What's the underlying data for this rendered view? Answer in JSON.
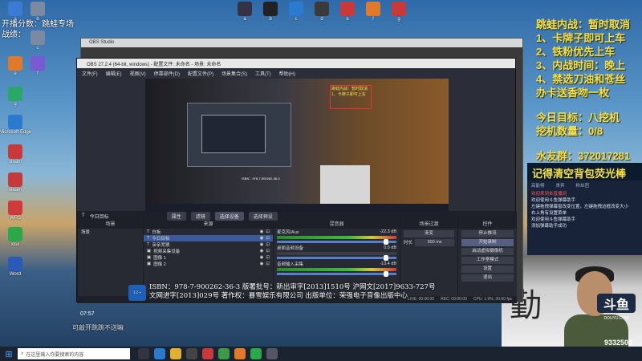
{
  "desktop_icons": [
    {
      "label": "a",
      "color": "#3b7bd4"
    },
    {
      "label": "b",
      "color": "#7a8aa0"
    },
    {
      "label": "c",
      "color": "#7a8aa0"
    },
    {
      "label": "e",
      "color": "#e07a2a"
    },
    {
      "label": "f",
      "color": "#7a5ad0"
    },
    {
      "label": "g",
      "color": "#2aa86a"
    },
    {
      "label": "Microsoft Edge",
      "color": "#2a7ad0"
    },
    {
      "label": "steam",
      "color": "#c83a3a"
    },
    {
      "label": "steam",
      "color": "#c83a3a"
    },
    {
      "label": "WPS",
      "color": "#d03a3a"
    },
    {
      "label": "xlsx",
      "color": "#2aa84a"
    },
    {
      "label": "Word",
      "color": "#2a5ab8"
    }
  ],
  "top_left_text": [
    "开播分数：跳蛙专场",
    "战绩："
  ],
  "rules": [
    "跳蛙内战：暂时取消",
    "1、卡牌子即可上车",
    "2、铁粉优先上车",
    "3、内战时间：晚上",
    "4、禁选刀油和苍丝",
    "办卡送香吻一枚",
    "",
    "今日目标：八挖机",
    "挖机数量：0/8",
    "",
    "水友群：372017281"
  ],
  "reminder": "记得清空背包荧光棒",
  "chat": {
    "tabs": [
      "高能榜",
      "贵宾",
      "粉丝团"
    ],
    "lines": [
      "欢迎来到本直播间",
      "欢迎使用斗鱼弹幕助手",
      "左键拖拽弹幕窗改变位置，左键拖拽边框改变大小",
      "右上角有设置菜单",
      "欢迎使用斗鱼弹幕助手",
      "添加弹幕助手成功"
    ]
  },
  "webcam": {
    "brand": "斗鱼",
    "brand_sub": "DOUYU.COM",
    "uid": "9332506",
    "calligraphy": "勤"
  },
  "obs": {
    "back_title": "OBS Studio",
    "title": "OBS 27.2.4 (64-bit, windows) - 配置文件: 未命名 - 场景: 未命名",
    "menu": [
      "文件(F)",
      "编辑(E)",
      "视图(V)",
      "停靠部件(D)",
      "配置文件(P)",
      "场景集合(S)",
      "工具(T)",
      "帮助(H)"
    ],
    "preview_note": "跳蛙内战：暂时取消 1、卡牌子即可上车",
    "preview_isbn": "ISBN：978-7-900262-36-3",
    "scenebar": {
      "source_label": "今日目标",
      "tabs": [
        "属性",
        "滤镜",
        "选择设备",
        "选择预设"
      ]
    },
    "panels": {
      "scenes": {
        "header": "场景",
        "items": [
          "场景"
        ]
      },
      "sources": {
        "header": "来源",
        "items": [
          "白板",
          "今日目标",
          "亲亲竞猜",
          "视频采集设备",
          "图像 1",
          "图像 2"
        ]
      },
      "mixer": {
        "header": "混音器",
        "channels": [
          {
            "name": "麦克风/Aux",
            "db": "-22.3 dB"
          },
          {
            "name": "桌面音频设备",
            "db": "0.0 dB"
          },
          {
            "name": "音频输入采集",
            "db": "-13.4 dB"
          }
        ]
      },
      "transitions": {
        "header": "场景过渡",
        "type": "渐变",
        "duration_label": "时长",
        "duration": "300 ms"
      },
      "controls": {
        "header": "控件",
        "buttons": [
          "停止推流",
          "开始录制",
          "启动虚拟摄像机",
          "工作室模式",
          "设置",
          "退出"
        ],
        "highlighted": 1
      }
    },
    "status": {
      "live": "LIVE: 00:00:00",
      "rec": "REC: 00:00:00",
      "cpu": "CPU: 1.9%, 30.00 fps"
    }
  },
  "isbn_text": [
    "ISBN：978-7-900262-36-3 版署批号：新出审字[2013]1510号 沪网文[2017]9633-727号",
    "文网进字[2013]029号 著作权：暴雪娱乐有限公司 出版单位：荣强电子音像出版中心"
  ],
  "timecode": "07:57",
  "bottom_note": "可敲开跳跳不送嘛",
  "taskbar": {
    "search_placeholder": "在这里输入你要搜索的内容",
    "apps": [
      {
        "name": "task-view-icon",
        "color": "#334"
      },
      {
        "name": "edge-icon",
        "color": "#2a7ad0"
      },
      {
        "name": "explorer-icon",
        "color": "#e0b030"
      },
      {
        "name": "obs-icon",
        "color": "#444"
      },
      {
        "name": "netease-icon",
        "color": "#c83a3a"
      },
      {
        "name": "chrome-icon",
        "color": "#3a9a4a"
      },
      {
        "name": "douyu-icon",
        "color": "#e07a2a"
      },
      {
        "name": "wechat-icon",
        "color": "#2aa84a"
      },
      {
        "name": "app-icon",
        "color": "#556"
      }
    ]
  },
  "top_icons": [
    {
      "label": "a",
      "color": "#334"
    },
    {
      "label": "b",
      "color": "#222"
    },
    {
      "label": "c",
      "color": "#2a7ad0"
    },
    {
      "label": "d",
      "color": "#3a3a3a"
    },
    {
      "label": "e",
      "color": "#c83a3a"
    },
    {
      "label": "f",
      "color": "#e07a2a"
    },
    {
      "label": "g",
      "color": "#c83a3a"
    }
  ]
}
